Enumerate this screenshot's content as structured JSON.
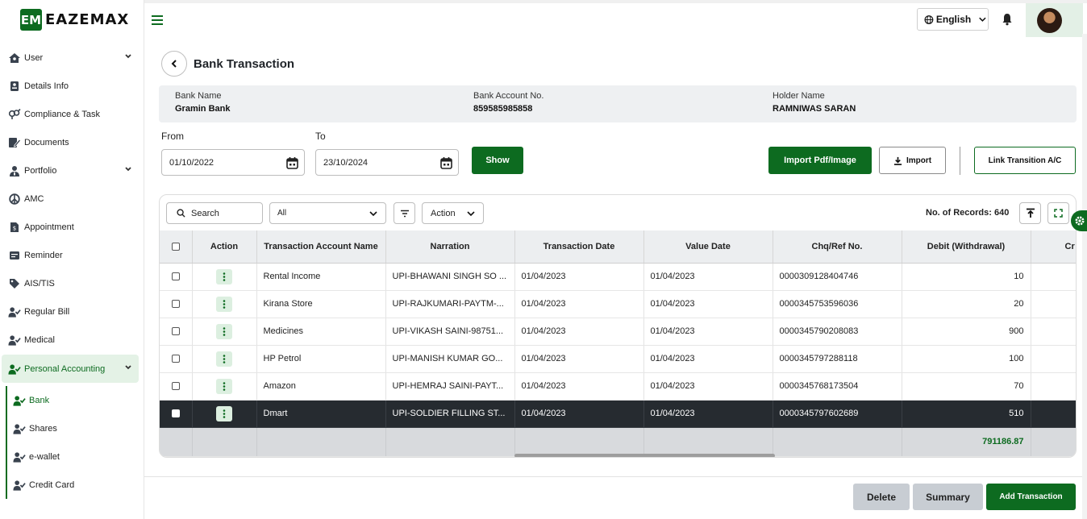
{
  "brand": {
    "name": "EAZEMAX",
    "mark": "EM"
  },
  "sidebar": {
    "items": [
      {
        "label": "User",
        "icon": "home-user-icon",
        "expandable": true
      },
      {
        "label": "Details Info",
        "icon": "id-card-icon"
      },
      {
        "label": "Compliance & Task",
        "icon": "gender-icon"
      },
      {
        "label": "Documents",
        "icon": "edit-doc-icon"
      },
      {
        "label": "Portfolio",
        "icon": "user-tie-icon",
        "expandable": true
      },
      {
        "label": "AMC",
        "icon": "peace-icon"
      },
      {
        "label": "Appointment",
        "icon": "invoice-icon"
      },
      {
        "label": "Reminder",
        "icon": "reminder-icon"
      },
      {
        "label": "AIS/TIS",
        "icon": "tag-icon"
      },
      {
        "label": "Regular Bill",
        "icon": "user-check-icon"
      },
      {
        "label": "Medical",
        "icon": "user-check-icon"
      },
      {
        "label": "Personal Accounting",
        "icon": "user-check-icon",
        "expandable": true,
        "active": true
      }
    ],
    "sub_items": [
      {
        "label": "Bank",
        "icon": "user-check-icon",
        "current": true
      },
      {
        "label": "Shares",
        "icon": "user-check-icon"
      },
      {
        "label": "e-wallet",
        "icon": "user-check-icon"
      },
      {
        "label": "Credit Card",
        "icon": "user-check-icon"
      }
    ]
  },
  "header": {
    "language": "English"
  },
  "page": {
    "title": "Bank Transaction"
  },
  "bank": {
    "name_label": "Bank Name",
    "name": "Gramin Bank",
    "account_label": "Bank Account No.",
    "account": "859585985858",
    "holder_label": "Holder Name",
    "holder": "RAMNIWAS SARAN"
  },
  "filters": {
    "from_label": "From",
    "from_value": "01/10/2022",
    "to_label": "To",
    "to_value": "23/10/2024",
    "show_label": "Show"
  },
  "actions": {
    "import_pdf": "Import Pdf/Image",
    "import": "Import",
    "link": "Link Transition A/C"
  },
  "table_toolbar": {
    "search_placeholder": "Search",
    "filter_select": "All",
    "action_select": "Action",
    "records_label": "No. of Records:",
    "records_count": "640"
  },
  "table": {
    "columns": [
      "",
      "Action",
      "Transaction Account Name",
      "Narration",
      "Transaction Date",
      "Value Date",
      "Chq/Ref No.",
      "Debit (Withdrawal)",
      "Cr"
    ],
    "rows": [
      {
        "account": "Rental Income",
        "narration": "UPI-BHAWANI SINGH SO ...",
        "txn_date": "01/04/2023",
        "value_date": "01/04/2023",
        "ref": "0000309128404746",
        "debit": "10"
      },
      {
        "account": "Kirana Store",
        "narration": "UPI-RAJKUMARI-PAYTM-...",
        "txn_date": "01/04/2023",
        "value_date": "01/04/2023",
        "ref": "0000345753596036",
        "debit": "20"
      },
      {
        "account": "Medicines",
        "narration": "UPI-VIKASH SAINI-98751...",
        "txn_date": "01/04/2023",
        "value_date": "01/04/2023",
        "ref": "0000345790208083",
        "debit": "900"
      },
      {
        "account": "HP Petrol",
        "narration": "UPI-MANISH KUMAR GO...",
        "txn_date": "01/04/2023",
        "value_date": "01/04/2023",
        "ref": "0000345797288118",
        "debit": "100"
      },
      {
        "account": "Amazon",
        "narration": "UPI-HEMRAJ SAINI-PAYT...",
        "txn_date": "01/04/2023",
        "value_date": "01/04/2023",
        "ref": "0000345768173504",
        "debit": "70"
      },
      {
        "account": "Dmart",
        "narration": "UPI-SOLDIER FILLING ST...",
        "txn_date": "01/04/2023",
        "value_date": "01/04/2023",
        "ref": "0000345797602689",
        "debit": "510",
        "selected": true
      }
    ],
    "total_debit": "791186.87"
  },
  "footer_buttons": {
    "delete": "Delete",
    "summary": "Summary",
    "add": "Add Transaction"
  },
  "colors": {
    "brand_green": "#0d6b20",
    "selected_row": "#262b30",
    "header_bg": "#eceef0"
  }
}
